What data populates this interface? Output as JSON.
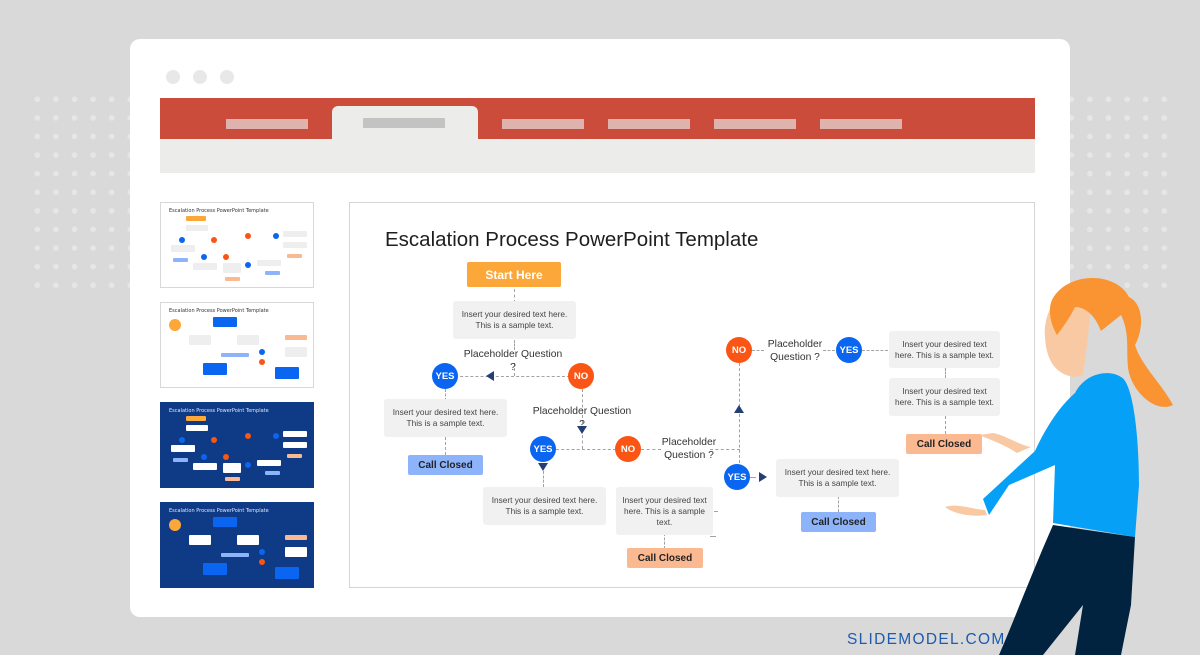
{
  "window": {
    "traffic_lights": [
      "close",
      "minimize",
      "maximize"
    ],
    "ribbon": {
      "color": "#cb4c3a",
      "tabs": [
        {
          "label": "",
          "active": false
        },
        {
          "label": "",
          "active": true
        },
        {
          "label": "",
          "active": false
        },
        {
          "label": "",
          "active": false
        },
        {
          "label": "",
          "active": false
        },
        {
          "label": "",
          "active": false
        }
      ]
    }
  },
  "thumbnails": [
    {
      "title": "Escalation Process PowerPoint Template",
      "theme": "light",
      "variant": "flowchart"
    },
    {
      "title": "Escalation Process PowerPoint Template",
      "theme": "light",
      "variant": "cycle"
    },
    {
      "title": "Escalation Process PowerPoint Template",
      "theme": "dark",
      "variant": "flowchart"
    },
    {
      "title": "Escalation Process PowerPoint Template",
      "theme": "dark",
      "variant": "cycle"
    }
  ],
  "slide": {
    "title": "Escalation Process PowerPoint Template",
    "start": "Start Here",
    "sample_text": "Insert your desired text here. This is a sample text.",
    "sample_text_wrapped": "Insert your desired text here. This is a sample text.",
    "question_1": "Placeholder Question ?",
    "question_2": "Placeholder Question ?",
    "question_3": "Placeholder Question ?",
    "question_4": "Placeholder Question ?",
    "yes": "YES",
    "no": "NO",
    "call_closed": "Call Closed",
    "colors": {
      "start": "#fca73a",
      "yes": "#0a66f1",
      "no": "#fa5514",
      "closed_blue": "#8db3fb",
      "closed_peach": "#fbb992",
      "arrow": "#243f73"
    }
  },
  "brand": "SLIDEMODEL.COM"
}
